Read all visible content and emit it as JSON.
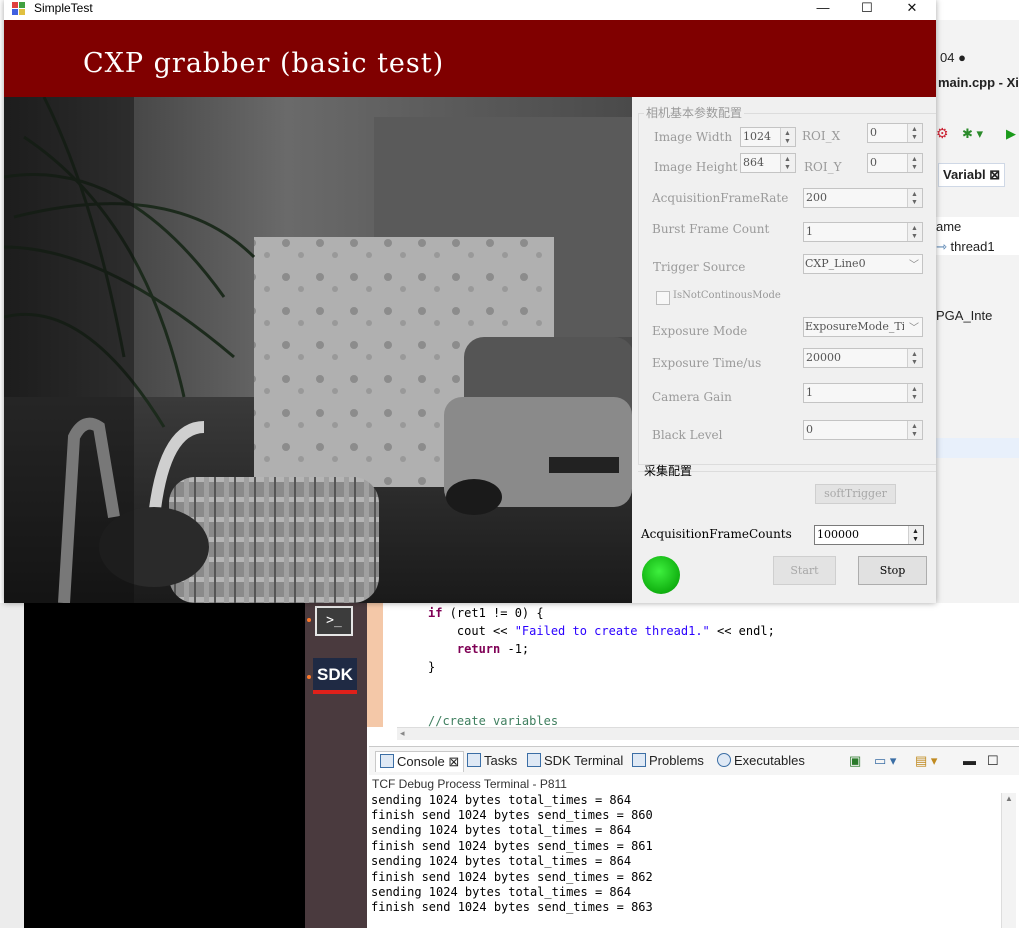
{
  "window": {
    "title": "SimpleTest",
    "controls": {
      "minimize": "—",
      "maximize": "☐",
      "close": "✕"
    }
  },
  "banner": {
    "title": "CXP grabber (basic test)"
  },
  "camera_params": {
    "group_title": "相机基本参数配置",
    "image_width": {
      "label": "Image Width",
      "value": "1024"
    },
    "roi_x": {
      "label": "ROI_X",
      "value": "0"
    },
    "image_height": {
      "label": "Image Height",
      "value": "864"
    },
    "roi_y": {
      "label": "ROI_Y",
      "value": "0"
    },
    "acq_frame_rate": {
      "label": "AcquisitionFrameRate",
      "value": "200"
    },
    "burst_frame_count": {
      "label": "Burst Frame Count",
      "value": "1"
    },
    "trigger_source": {
      "label": "Trigger Source",
      "value": "CXP_Line0"
    },
    "not_continuous": {
      "label": "IsNotContinousMode"
    },
    "exposure_mode": {
      "label": "Exposure Mode",
      "value": "ExposureMode_Timed"
    },
    "exposure_time": {
      "label": "Exposure Time/us",
      "value": "20000"
    },
    "camera_gain": {
      "label": "Camera Gain",
      "value": "1"
    },
    "black_level": {
      "label": "Black Level",
      "value": "0"
    }
  },
  "acquisition": {
    "group_title": "采集配置",
    "soft_trigger": "softTrigger",
    "frame_counts": {
      "label": "AcquisitionFrameCounts",
      "value": "100000"
    },
    "start": "Start",
    "stop": "Stop",
    "status_color": "#1fcf1f"
  },
  "ide": {
    "right_strip": {
      "tab_title": "main.cpp - Xil",
      "badge": "04 ●",
      "variables_tab": "Variabl",
      "name_header": "ame",
      "thread_item": "thread1",
      "fpga_tab": "PGA_Inte"
    },
    "dock": {
      "terminal_label": ">_",
      "sdk_label": "SDK"
    },
    "code": [
      {
        "kw": "if",
        "rest": " (ret1 != 0) {"
      },
      {
        "plain": "    cout << ",
        "str": "\"Failed to create thread1.\"",
        "tail": " << endl;"
      },
      {
        "kw": "    return",
        "rest": " -1;"
      },
      {
        "plain": "}"
      },
      {
        "plain": ""
      },
      {
        "cmt": "//create variables"
      }
    ],
    "console_tabs": [
      "Console",
      "Tasks",
      "SDK Terminal",
      "Problems",
      "Executables"
    ],
    "console_title": "TCF Debug Process Terminal - P811",
    "console_lines": [
      "sending 1024 bytes total_times = 864",
      "finish send 1024 bytes send_times = 860",
      "sending 1024 bytes total_times = 864",
      "finish send 1024 bytes send_times = 861",
      "sending 1024 bytes total_times = 864",
      "finish send 1024 bytes send_times = 862",
      "sending 1024 bytes total_times = 864",
      "finish send 1024 bytes send_times = 863"
    ]
  }
}
